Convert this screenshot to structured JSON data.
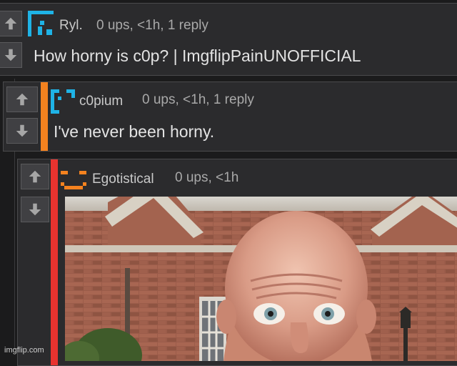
{
  "comments": [
    {
      "username": "Ryl.",
      "meta": "0 ups, <1h, 1 reply",
      "text": "How horny is c0p? | ImgflipPainUNOFFICIAL",
      "avatar_color": "#1fb3e6"
    },
    {
      "username": "c0pium",
      "meta": "0 ups, <1h, 1 reply",
      "text": "I've never been horny.",
      "avatar_color": "#1fb3e6",
      "stripe_color": "#f4821f"
    },
    {
      "username": "Egotistical",
      "meta": "0 ups, <1h",
      "avatar_color": "#f4821f",
      "stripe_color": "#e8332f",
      "image": {
        "kind": "photo-meme",
        "icon": "bald-man-brick-mansion-photo"
      }
    }
  ],
  "icons": {
    "upvote": "arrow-up-icon",
    "downvote": "arrow-down-icon"
  },
  "watermark": "imgflip.com"
}
